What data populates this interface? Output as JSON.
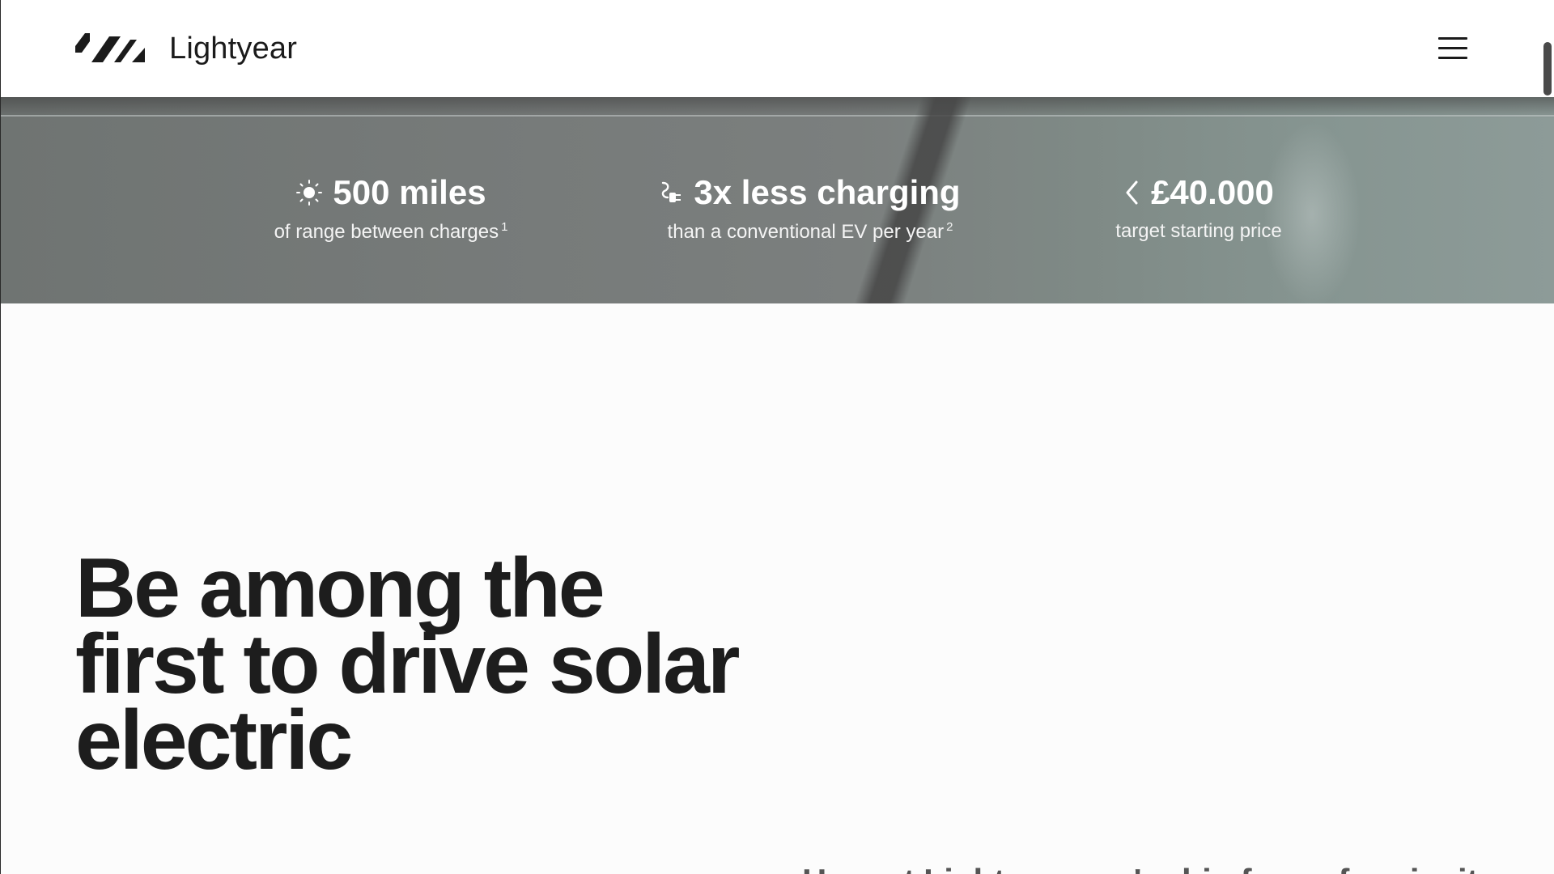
{
  "header": {
    "brand": "Lightyear",
    "logo_icon": "lightyear-logo-mark",
    "menu_icon": "hamburger-menu-icon"
  },
  "stats": [
    {
      "icon": "sun-icon",
      "value": "500 miles",
      "label": "of range between charges",
      "footnote": "1"
    },
    {
      "icon": "charging-plug-icon",
      "value": "3x less charging",
      "label": "than a conventional EV per year",
      "footnote": "2"
    },
    {
      "icon": "chevron-left-icon",
      "value": "£40.000",
      "label": "target starting price",
      "footnote": ""
    }
  ],
  "hero": {
    "title_line1": "Be among the",
    "title_line2": "first to drive solar",
    "title_line3": "electric"
  },
  "intro": {
    "text": "Here at Lightyear, we're big fans of curiosity."
  },
  "colors": {
    "text_dark": "#1b1b1b",
    "band": "#7b7f7e",
    "page_bg": "#fcfcfc",
    "intro_text": "#555555"
  }
}
